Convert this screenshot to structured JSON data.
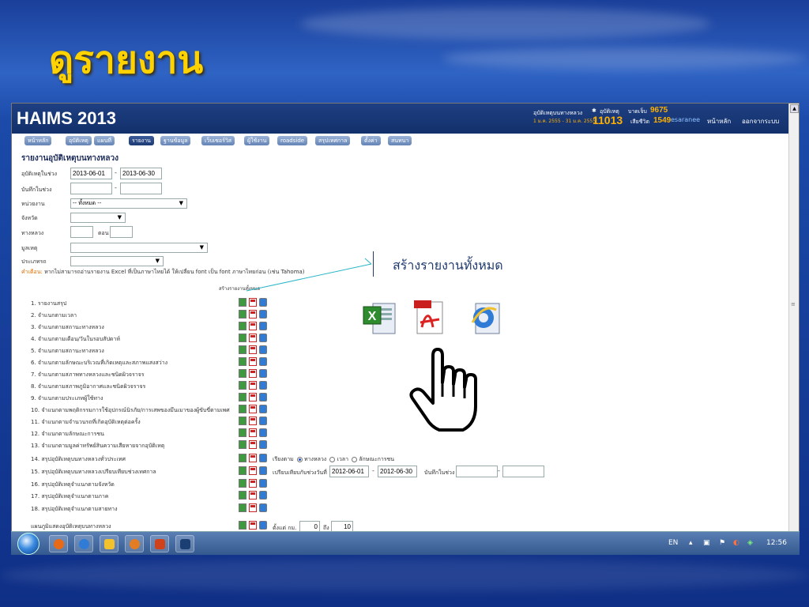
{
  "slide": {
    "title": "ดูรายงาน"
  },
  "app": {
    "title": "HAIMS 2013",
    "stats": {
      "label_main": "อุบัติเหตุบนทางหลวง",
      "date_range": "1 ม.ค. 2555 - 31 ม.ค. 2555",
      "total": "11013",
      "label_accidents": "อุบัติเหตุ",
      "accidents": "9675",
      "label_injured": "บาดเจ็บ",
      "label_deaths": "เสียชีวิต",
      "deaths": "1549"
    },
    "user": "esaranee",
    "home_link": "หน้าหลัก",
    "logout_link": "ออกจากระบบ",
    "menu": [
      "หน้าหลัก",
      "อุบัติเหตุ",
      "แผนที่",
      "รายงาน",
      "ฐานข้อมูล",
      "เว็บเซอร์วิส",
      "ผู้ใช้งาน",
      "roadside",
      "สรุปเทศกาล",
      "ตั้งค่า",
      "สนทนา"
    ]
  },
  "form": {
    "title": "รายงานอุบัติเหตุบนทางหลวง",
    "accident_period_label": "อุบัติเหตุในช่วง",
    "date_from": "2013-06-01",
    "date_to": "2013-06-30",
    "record_period_label": "บันทึกในช่วง",
    "unit_label": "หน่วยงาน",
    "unit_value": "-- ทั้งหมด --",
    "province_label": "จังหวัด",
    "highway_label": "ทางหลวง",
    "section_label": "ตอน",
    "cause_label": "มูลเหตุ",
    "type_label": "ประเภทรถ",
    "warning_prefix": "คำเตือน:",
    "warning_text": " หากไม่สามารถอ่านรายงาน Excel ที่เป็นภาษาไทยได้ ให้เปลี่ยน font เป็น font ภาษาไทยก่อน (เช่น Tahoma)",
    "create_all_link": "สร้างรายงานทั้งหมด"
  },
  "reports": [
    "1.  รายงานสรุป",
    "2.  จำแนกตามเวลา",
    "3.  จำแนกตามสถานะทางหลวง",
    "4.  จำแนกตามเดือน/วันในรอบสัปดาห์",
    "5.  จำแนกตามสถานะทางหลวง",
    "6.  จำแนกตามลักษณะบริเวณที่เกิดเหตุและสภาพแสงสว่าง",
    "7.  จำแนกตามสภาพทางหลวงและชนิดผิวจราจร",
    "8.  จำแนกตามสภาพภูมิอากาศและชนิดผิวจราจร",
    "9.  จำแนกตามประเภทผู้ใช้ทาง",
    "10.  จำแนกตามพฤติกรรมการใช้อุปกรณ์นิรภัย/การเสพของมึนเมาของผู้ขับขี่ตามเพศ",
    "11.  จำแนกตามจำนวนรถที่เกิดอุบัติเหตุต่อครั้ง",
    "12.  จำแนกตามลักษณะการชน",
    "13.  จำแนกตามมูลค่าทรัพย์สินความเสียหายจากอุบัติเหตุ",
    "14.  สรุปอุบัติเหตุบนทางหลวงทั่วประเทศ",
    "15.  สรุปอุบัติเหตุบนทางหลวงเปรียบเทียบช่วงเทศกาล",
    "16.  สรุปอุบัติเหตุจำแนกตามจังหวัด",
    "17.  สรุปอุบัติเหตุจำแนกตามภาค",
    "18.  สรุปอุบัติเหตุจำแนกตามสายทาง"
  ],
  "report14": {
    "sort_label": "เรียงตาม",
    "opt1": "ทางหลวง",
    "opt2": "เวลา",
    "opt3": "ลักษณะการชน"
  },
  "report15": {
    "compare_label": "เปรียบเทียบกับช่วงวันที่",
    "from": "2012-06-01",
    "to": "2012-06-30",
    "record_label": "บันทึกในช่วง"
  },
  "map_row": {
    "label": "แผนภูมิแสดงอุบัติเหตุบนทางหลวง",
    "from_label": "ตั้งแต่ กม.",
    "from": "0",
    "to_label": "ถึง",
    "to": "10"
  },
  "callout": {
    "text": "สร้างรายงานทั้งหมด"
  },
  "taskbar": {
    "lang": "EN",
    "time": "12:56"
  },
  "colors": {
    "title": "#ffd200",
    "header": "#1e3f82",
    "accent_orange": "#ffb000"
  }
}
